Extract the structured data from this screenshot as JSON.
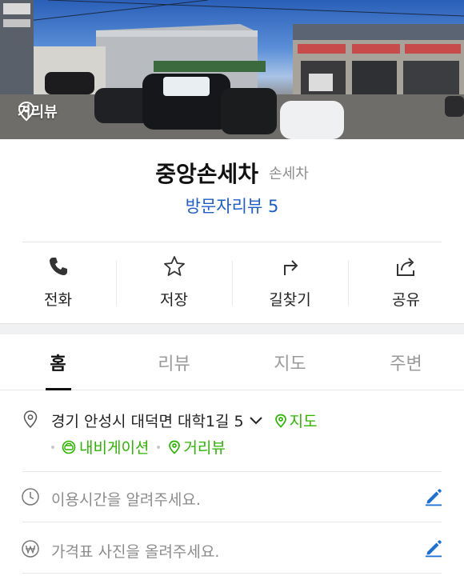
{
  "photo": {
    "street_view_label": "거리뷰"
  },
  "place": {
    "name": "중앙손세차",
    "category": "손세차",
    "review_link": "방문자리뷰 5"
  },
  "actions": [
    {
      "label": "전화",
      "icon": "phone-icon"
    },
    {
      "label": "저장",
      "icon": "star-icon"
    },
    {
      "label": "길찾기",
      "icon": "directions-icon"
    },
    {
      "label": "공유",
      "icon": "share-icon"
    }
  ],
  "tabs": [
    {
      "label": "홈",
      "active": true
    },
    {
      "label": "리뷰",
      "active": false
    },
    {
      "label": "지도",
      "active": false
    },
    {
      "label": "주변",
      "active": false
    }
  ],
  "info": {
    "address": "경기 안성시 대덕면 대학1길 5",
    "map_link": "지도",
    "navigation_link": "내비게이션",
    "street_view_link": "거리뷰",
    "hours_prompt": "이용시간을 알려주세요.",
    "price_prompt": "가격표 사진을 올려주세요."
  },
  "colors": {
    "accent_blue": "#1d5ec9",
    "link_green": "#2db400",
    "edit_blue": "#1d6fd8"
  }
}
